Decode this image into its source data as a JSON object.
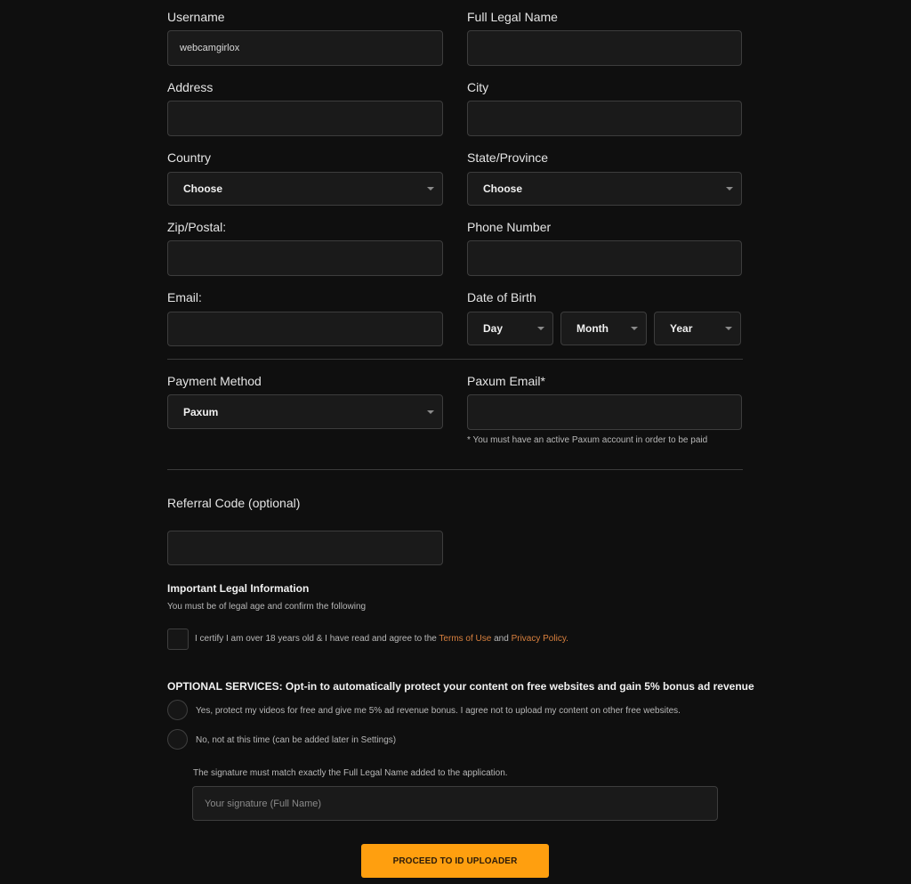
{
  "form": {
    "username": {
      "label": "Username",
      "value": "webcamgirlox"
    },
    "full_legal_name": {
      "label": "Full Legal Name",
      "value": ""
    },
    "address": {
      "label": "Address",
      "value": ""
    },
    "city": {
      "label": "City",
      "value": ""
    },
    "country": {
      "label": "Country",
      "selected": "Choose"
    },
    "state": {
      "label": "State/Province",
      "selected": "Choose"
    },
    "zip": {
      "label": "Zip/Postal:",
      "value": ""
    },
    "phone": {
      "label": "Phone Number",
      "value": ""
    },
    "email": {
      "label": "Email:",
      "value": ""
    },
    "dob": {
      "label": "Date of Birth",
      "day": "Day",
      "month": "Month",
      "year": "Year"
    },
    "payment_method": {
      "label": "Payment Method",
      "selected": "Paxum"
    },
    "paxum_email": {
      "label": "Paxum Email*",
      "value": "",
      "note": "* You must have an active Paxum account in order to be paid"
    },
    "referral": {
      "label": "Referral Code (optional)",
      "value": ""
    }
  },
  "legal": {
    "title": "Important Legal Information",
    "subtitle": "You must be of legal age and confirm the following",
    "certify_prefix": "I certify I am over 18 years old & I have read and agree to the ",
    "terms_link": "Terms of Use",
    "and_text": " and ",
    "privacy_link": "Privacy Policy",
    "period": ".",
    "checked": false
  },
  "optional_services": {
    "title": "OPTIONAL SERVICES: Opt-in to automatically protect your content on free websites and gain 5% bonus ad revenue",
    "options": [
      {
        "label": "Yes, protect my videos for free and give me 5% ad revenue bonus. I agree not to upload my content on other free websites.",
        "selected": false
      },
      {
        "label": "No, not at this time (can be added later in Settings)",
        "selected": false
      }
    ]
  },
  "signature": {
    "note": "The signature must match exactly the Full Legal Name added to the application.",
    "placeholder": "Your signature (Full Name)",
    "value": ""
  },
  "submit": {
    "label": "PROCEED TO ID UPLOADER"
  },
  "colors": {
    "accent": "#ff9f0f",
    "link": "#d9803e",
    "background": "#0f0f0f"
  }
}
